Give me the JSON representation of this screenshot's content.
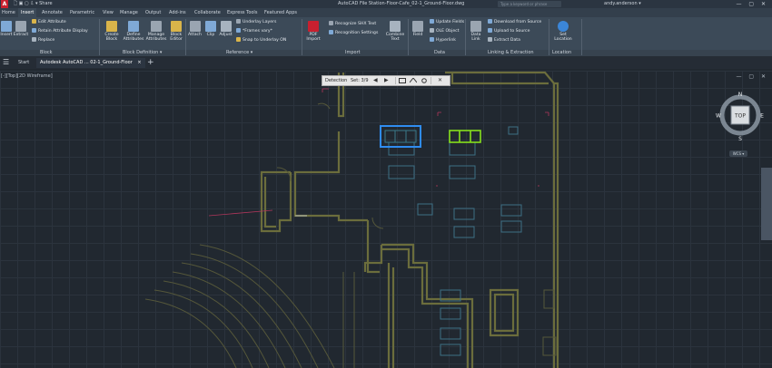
{
  "app": {
    "logo": "A",
    "qat": "🗋 ▣ ▢ ⇩ ▾   Share",
    "doc_title": "AutoCAD File Station-Floor-Cafe_02-1_Ground-Floor.dwg",
    "search_placeholder": "Type a keyword or phrase",
    "user": "andy.anderson ▾",
    "window_controls": "— ▢ ✕"
  },
  "ribbon_tabs": [
    "Home",
    "Insert",
    "Annotate",
    "Parametric",
    "View",
    "Manage",
    "Output",
    "Add-ins",
    "Collaborate",
    "Express Tools",
    "Featured Apps"
  ],
  "ribbon": {
    "insert_btn": "Insert",
    "extract_btn": "Extract",
    "edit_attribute": "Edit Attribute",
    "retain_attribute_display": "Retain Attribute Display",
    "replace": "Replace",
    "create_block": "Create Block",
    "define_attributes": "Define Attributes",
    "manage_attributes": "Manage Attributes",
    "block_editor": "Block Editor",
    "attach": "Attach",
    "clip": "Clip",
    "adjust": "Adjust",
    "underlay_layers": "Underlay Layers",
    "frames_vary": "*Frames vary*",
    "snap_to_underlay": "Snap to Underlay ON",
    "pdf_import": "PDF Import",
    "recognize_shx_text": "Recognize SHX Text",
    "recognition_settings": "Recognition Settings",
    "combine_text": "Combine Text",
    "field": "Field",
    "update_fields": "Update Fields",
    "ole_object": "OLE Object",
    "hyperlink": "Hyperlink",
    "data_link": "Data Link",
    "download_from_source": "Download from Source",
    "upload_to_source": "Upload to Source",
    "extract_data": "Extract Data",
    "set_location": "Set Location"
  },
  "panel_labels": [
    "Block",
    "Block Definition ▾",
    "Reference ▾",
    "Import",
    "Data",
    "Linking & Extraction",
    "Location"
  ],
  "doc_tabs": {
    "menu": "☰",
    "start": "Start",
    "active": "Autodesk AutoCAD ... 02-1_Ground-Floor",
    "close": "×",
    "new": "+"
  },
  "viewport": {
    "label": "[-][Top][2D Wireframe]",
    "controls": "— ▢ ✕"
  },
  "selection_bar": {
    "label": "Detection",
    "count": "Set: 3/9",
    "prev": "◀",
    "next": "▶",
    "close": "✕"
  },
  "viewcube": {
    "n": "N",
    "s": "S",
    "e": "E",
    "w": "W",
    "top": "TOP"
  },
  "wcs": "WCS ▾",
  "colors": {
    "accent": "#3b86d8",
    "highlight_blue": "#2f8cf0",
    "highlight_green": "#86e01c",
    "wall": "#6b6d3c",
    "furniture": "#3d6f85"
  }
}
